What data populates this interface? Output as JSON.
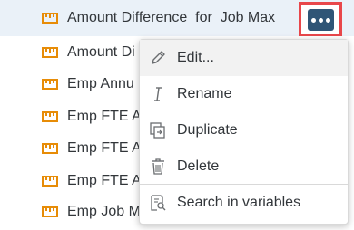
{
  "list": {
    "items": [
      {
        "label": "Amount Difference_for_Job Max",
        "icon": "measure-icon",
        "selected": true
      },
      {
        "label": "Amount Di",
        "icon": "measure-icon"
      },
      {
        "label": "Emp Annu",
        "icon": "measure-icon"
      },
      {
        "label": "Emp FTE A",
        "icon": "measure-icon"
      },
      {
        "label": "Emp FTE A",
        "icon": "measure-icon"
      },
      {
        "label": "Emp FTE A",
        "icon": "measure-icon"
      },
      {
        "label": "Emp Job M",
        "icon": "measure-icon"
      }
    ]
  },
  "more_button": {
    "icon": "more-icon"
  },
  "menu": {
    "items": [
      {
        "label": "Edit...",
        "icon": "pencil-icon"
      },
      {
        "label": "Rename",
        "icon": "italic-i-icon"
      },
      {
        "label": "Duplicate",
        "icon": "duplicate-icon"
      },
      {
        "label": "Delete",
        "icon": "trash-icon"
      },
      {
        "label": "Search in variables",
        "icon": "search-document-icon"
      }
    ]
  },
  "colors": {
    "accent": "#2f5576",
    "highlight": "#e8474b",
    "icon_orange": "#e78c07"
  }
}
